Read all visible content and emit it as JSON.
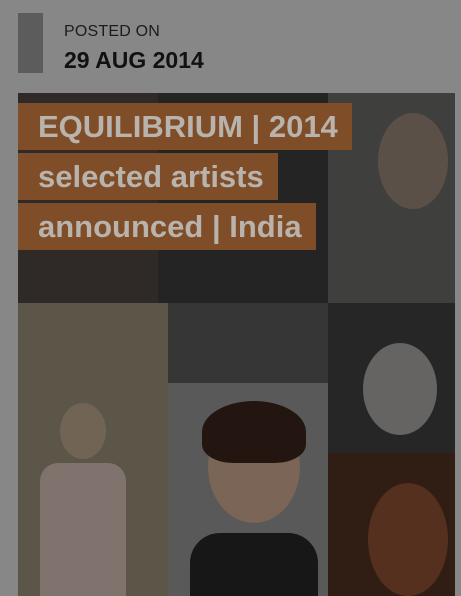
{
  "post": {
    "posted_label": "POSTED ON",
    "posted_date": "29 AUG 2014"
  },
  "featured": {
    "title_lines": [
      "EQUILIBRIUM | 2014",
      "selected artists",
      "announced | India"
    ],
    "colors": {
      "title_bg": "#7f4d28",
      "title_text": "#b9b3ad",
      "page_bg": "#878787"
    }
  }
}
